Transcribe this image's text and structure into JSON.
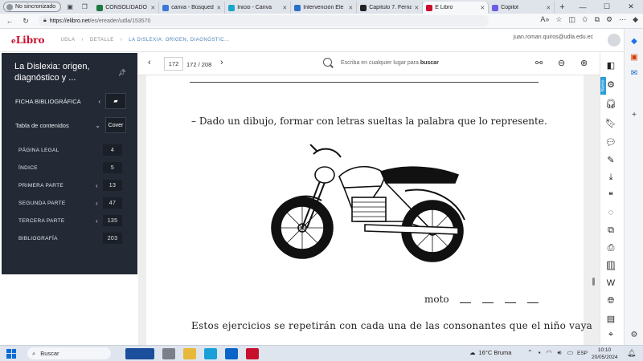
{
  "browser": {
    "profile_label": "No sincronizado",
    "tabs": [
      {
        "label": "CONSOLIDADO",
        "favicon_color": "#1d7a3e",
        "active": false
      },
      {
        "label": "canva - Búsqueda",
        "favicon_color": "#3b78d8",
        "active": false
      },
      {
        "label": "Inicio - Canva",
        "favicon_color": "#1aa6c8",
        "active": false
      },
      {
        "label": "Intervención Ele",
        "favicon_color": "#2c6fc9",
        "active": false
      },
      {
        "label": "Capítulo 7. Ferna",
        "favicon_color": "#222222",
        "active": false
      },
      {
        "label": "E Libro",
        "favicon_color": "#c8102e",
        "active": true
      },
      {
        "label": "Copilot",
        "favicon_color": "#6b5ce7",
        "active": false
      }
    ],
    "url_host": "https://elibro.net",
    "url_path": "/es/ereader/udla/153570"
  },
  "header": {
    "logo_prefix": "e",
    "logo_main": "Libro",
    "breadcrumbs": [
      "UDLA",
      "DETALLE",
      "LA DISLEXIA: ORIGEN, DIAGNÓSTIC..."
    ],
    "user_email": "juan.roman.quiros@udla.edu.ec"
  },
  "sidebar": {
    "book_title": "La Dislexia: origen, diagnóstico y ...",
    "ficha_label": "FICHA BIBLIOGRÁFICA",
    "toc_label": "Tabla de contenidos",
    "cover_label": "Cover",
    "toc": [
      {
        "label": "PÁGINA LEGAL",
        "page": "4",
        "has_children": false
      },
      {
        "label": "ÍNDICE",
        "page": "5",
        "has_children": false
      },
      {
        "label": "PRIMERA PARTE",
        "page": "13",
        "has_children": true
      },
      {
        "label": "SEGUNDA PARTE",
        "page": "47",
        "has_children": true
      },
      {
        "label": "TERCERA PARTE",
        "page": "135",
        "has_children": true
      },
      {
        "label": "BIBLIOGRAFÍA",
        "page": "203",
        "has_children": false
      }
    ]
  },
  "reader": {
    "page_input": "172",
    "page_count": "172 / 208",
    "search_placeholder": "Escriba en cualquier lugar para",
    "search_bold": "buscar"
  },
  "page_content": {
    "line1": "–  Dado un dibujo, formar con letras sueltas la palabra que lo represente.",
    "moto_word": "moto",
    "line2": "Estos ejercicios se repetirán con cada una de las consonantes que el niño vaya"
  },
  "right_tools": {
    "nuevo_badge": "Nuevo"
  },
  "taskbar": {
    "search_label": "Buscar",
    "weather": "16°C  Bruma",
    "lang": "ESP",
    "time": "10:10",
    "date": "20/05/2024"
  }
}
